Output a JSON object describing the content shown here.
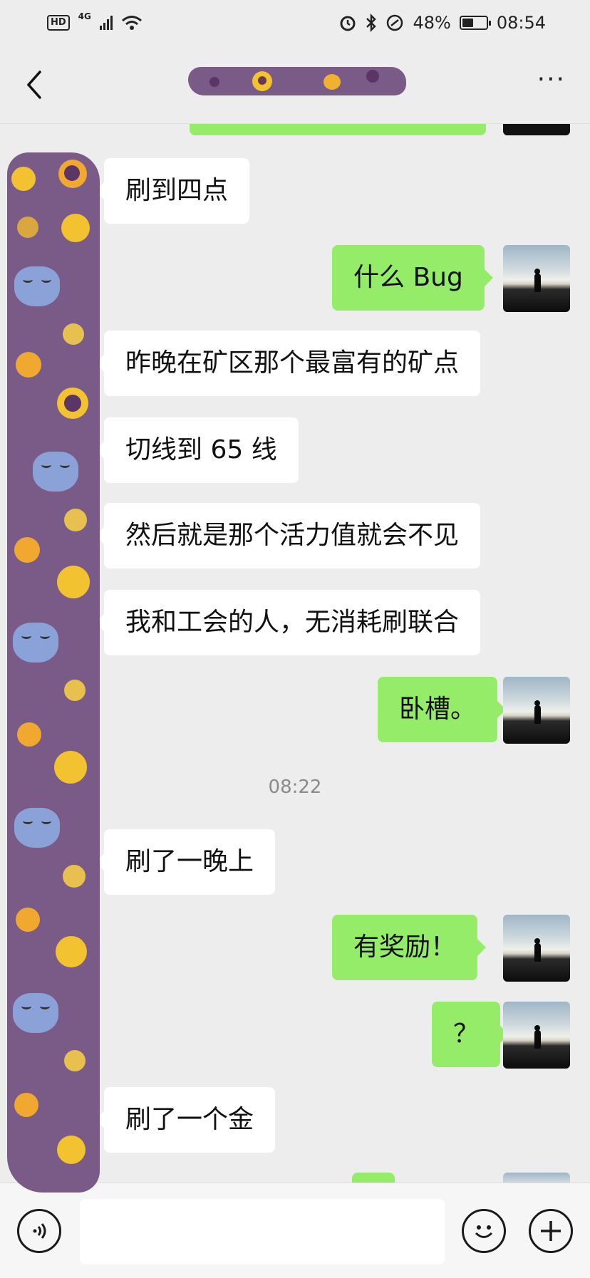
{
  "status_bar": {
    "network_badge": "HD",
    "network_type": "4G",
    "battery_percent": "48%",
    "battery_level": 0.48,
    "time": "08:54",
    "icons": [
      "hd-icon",
      "signal-icon",
      "wifi-icon",
      "alarm-icon",
      "bluetooth-icon",
      "nfc-icon",
      "battery-icon"
    ]
  },
  "nav": {
    "back_icon": "chevron-left-icon",
    "more_label": "···"
  },
  "messages": [
    {
      "side": "in",
      "text": "刷到四点"
    },
    {
      "side": "out",
      "text": "什么 Bug"
    },
    {
      "side": "in",
      "text": "昨晚在矿区那个最富有的矿点"
    },
    {
      "side": "in",
      "text": "切线到 65 线"
    },
    {
      "side": "in",
      "text": "然后就是那个活力值就会不见"
    },
    {
      "side": "in",
      "text": "我和工会的人，无消耗刷联合"
    },
    {
      "side": "out",
      "text": "卧槽。"
    },
    {
      "side": "time",
      "text": "08:22"
    },
    {
      "side": "in",
      "text": "刷了一晚上"
    },
    {
      "side": "out",
      "text": "有奖励！"
    },
    {
      "side": "out",
      "text": "？"
    },
    {
      "side": "in",
      "text": "刷了一个金"
    }
  ],
  "input_bar": {
    "voice_icon": "voice-icon",
    "emoji_icon": "emoji-icon",
    "plus_icon": "plus-icon",
    "placeholder": ""
  },
  "colors": {
    "background": "#ededed",
    "incoming_bubble": "#ffffff",
    "outgoing_bubble": "#95ec69",
    "redaction": "#7a5a86"
  }
}
